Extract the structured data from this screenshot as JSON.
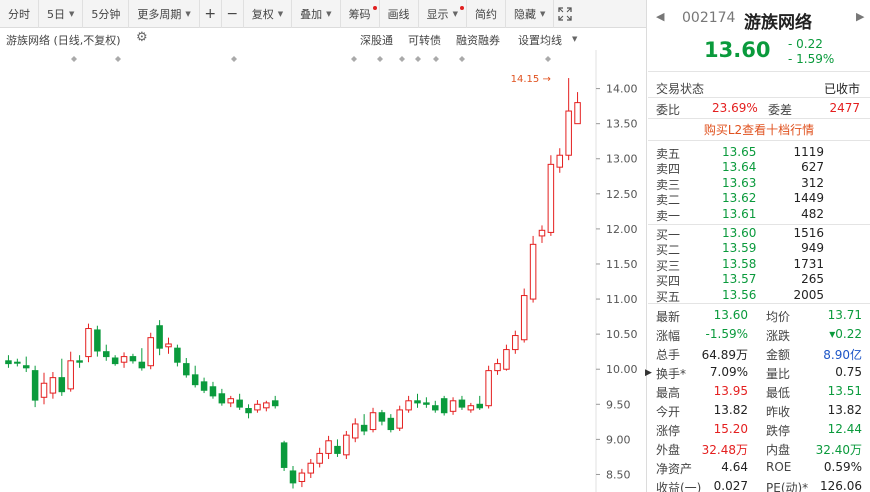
{
  "toolbar": {
    "buttons": [
      {
        "label": "分时",
        "dropdown": false,
        "dot": false
      },
      {
        "label": "5日",
        "dropdown": true,
        "dot": false
      },
      {
        "label": "5分钟",
        "dropdown": false,
        "dot": false
      },
      {
        "label": "更多周期",
        "dropdown": true,
        "dot": false
      }
    ],
    "zoom_in": "+",
    "zoom_out": "−",
    "buttons2": [
      {
        "label": "复权",
        "dropdown": true,
        "dot": false
      },
      {
        "label": "叠加",
        "dropdown": true,
        "dot": false
      },
      {
        "label": "筹码",
        "dropdown": false,
        "dot": true
      },
      {
        "label": "画线",
        "dropdown": false,
        "dot": false
      },
      {
        "label": "显示",
        "dropdown": true,
        "dot": true
      },
      {
        "label": "简约",
        "dropdown": false,
        "dot": false
      },
      {
        "label": "隐藏",
        "dropdown": true,
        "dot": false
      }
    ],
    "fullscreen_icon": "expand-icon"
  },
  "subheader": {
    "stock_label": "游族网络 (日线,不复权)",
    "links": [
      "深股通",
      "可转债",
      "融资融券",
      "设置均线"
    ]
  },
  "chart_data": {
    "type": "candlestick",
    "ylim": [
      8.25,
      14.55
    ],
    "yticks": [
      8.5,
      9.0,
      9.5,
      10.0,
      10.5,
      11.0,
      11.5,
      12.0,
      12.5,
      13.0,
      13.5,
      14.0
    ],
    "ytick_labels": [
      "8.50",
      "9.00",
      "9.50",
      "10.00",
      "10.50",
      "11.00",
      "11.50",
      "12.00",
      "12.50",
      "13.00",
      "13.50",
      "14.00"
    ],
    "max_label": "14.15",
    "max_value": 14.15,
    "up_color": "#e41f1f",
    "down_color": "#0a9a3c",
    "candles": [
      {
        "o": 10.12,
        "h": 10.2,
        "l": 10.02,
        "c": 10.08
      },
      {
        "o": 10.1,
        "h": 10.15,
        "l": 10.04,
        "c": 10.09
      },
      {
        "o": 10.05,
        "h": 10.18,
        "l": 9.96,
        "c": 10.02
      },
      {
        "o": 9.98,
        "h": 10.05,
        "l": 9.46,
        "c": 9.56
      },
      {
        "o": 9.6,
        "h": 9.95,
        "l": 9.5,
        "c": 9.8
      },
      {
        "o": 9.66,
        "h": 9.96,
        "l": 9.58,
        "c": 9.88
      },
      {
        "o": 9.88,
        "h": 10.15,
        "l": 9.62,
        "c": 9.68
      },
      {
        "o": 9.72,
        "h": 10.25,
        "l": 9.68,
        "c": 10.12
      },
      {
        "o": 10.12,
        "h": 10.2,
        "l": 10.02,
        "c": 10.1
      },
      {
        "o": 10.18,
        "h": 10.65,
        "l": 10.1,
        "c": 10.58
      },
      {
        "o": 10.56,
        "h": 10.62,
        "l": 10.18,
        "c": 10.26
      },
      {
        "o": 10.25,
        "h": 10.35,
        "l": 10.12,
        "c": 10.18
      },
      {
        "o": 10.16,
        "h": 10.2,
        "l": 10.05,
        "c": 10.08
      },
      {
        "o": 10.1,
        "h": 10.24,
        "l": 10.02,
        "c": 10.18
      },
      {
        "o": 10.18,
        "h": 10.22,
        "l": 10.08,
        "c": 10.12
      },
      {
        "o": 10.1,
        "h": 10.3,
        "l": 9.98,
        "c": 10.02
      },
      {
        "o": 10.05,
        "h": 10.52,
        "l": 10.0,
        "c": 10.45
      },
      {
        "o": 10.62,
        "h": 10.7,
        "l": 10.2,
        "c": 10.3
      },
      {
        "o": 10.32,
        "h": 10.45,
        "l": 10.22,
        "c": 10.36
      },
      {
        "o": 10.3,
        "h": 10.35,
        "l": 10.04,
        "c": 10.1
      },
      {
        "o": 10.08,
        "h": 10.16,
        "l": 9.88,
        "c": 9.92
      },
      {
        "o": 9.92,
        "h": 10.05,
        "l": 9.74,
        "c": 9.78
      },
      {
        "o": 9.82,
        "h": 9.88,
        "l": 9.66,
        "c": 9.7
      },
      {
        "o": 9.75,
        "h": 9.82,
        "l": 9.58,
        "c": 9.62
      },
      {
        "o": 9.65,
        "h": 9.72,
        "l": 9.48,
        "c": 9.52
      },
      {
        "o": 9.52,
        "h": 9.62,
        "l": 9.46,
        "c": 9.58
      },
      {
        "o": 9.56,
        "h": 9.65,
        "l": 9.42,
        "c": 9.46
      },
      {
        "o": 9.44,
        "h": 9.5,
        "l": 9.3,
        "c": 9.38
      },
      {
        "o": 9.42,
        "h": 9.56,
        "l": 9.38,
        "c": 9.5
      },
      {
        "o": 9.45,
        "h": 9.55,
        "l": 9.4,
        "c": 9.52
      },
      {
        "o": 9.55,
        "h": 9.62,
        "l": 9.44,
        "c": 9.48
      },
      {
        "o": 8.95,
        "h": 8.98,
        "l": 8.55,
        "c": 8.6
      },
      {
        "o": 8.55,
        "h": 8.62,
        "l": 8.3,
        "c": 8.38
      },
      {
        "o": 8.4,
        "h": 8.58,
        "l": 8.32,
        "c": 8.52
      },
      {
        "o": 8.52,
        "h": 8.72,
        "l": 8.45,
        "c": 8.66
      },
      {
        "o": 8.66,
        "h": 8.88,
        "l": 8.6,
        "c": 8.8
      },
      {
        "o": 8.8,
        "h": 9.05,
        "l": 8.72,
        "c": 8.98
      },
      {
        "o": 8.9,
        "h": 9.0,
        "l": 8.75,
        "c": 8.8
      },
      {
        "o": 8.78,
        "h": 9.12,
        "l": 8.72,
        "c": 9.06
      },
      {
        "o": 9.02,
        "h": 9.3,
        "l": 8.96,
        "c": 9.22
      },
      {
        "o": 9.2,
        "h": 9.36,
        "l": 9.06,
        "c": 9.12
      },
      {
        "o": 9.14,
        "h": 9.45,
        "l": 9.1,
        "c": 9.38
      },
      {
        "o": 9.38,
        "h": 9.42,
        "l": 9.2,
        "c": 9.26
      },
      {
        "o": 9.3,
        "h": 9.36,
        "l": 9.1,
        "c": 9.14
      },
      {
        "o": 9.16,
        "h": 9.48,
        "l": 9.12,
        "c": 9.42
      },
      {
        "o": 9.42,
        "h": 9.62,
        "l": 9.38,
        "c": 9.55
      },
      {
        "o": 9.55,
        "h": 9.65,
        "l": 9.45,
        "c": 9.52
      },
      {
        "o": 9.52,
        "h": 9.6,
        "l": 9.45,
        "c": 9.5
      },
      {
        "o": 9.48,
        "h": 9.55,
        "l": 9.38,
        "c": 9.42
      },
      {
        "o": 9.58,
        "h": 9.62,
        "l": 9.34,
        "c": 9.38
      },
      {
        "o": 9.4,
        "h": 9.6,
        "l": 9.35,
        "c": 9.55
      },
      {
        "o": 9.56,
        "h": 9.62,
        "l": 9.42,
        "c": 9.46
      },
      {
        "o": 9.42,
        "h": 9.52,
        "l": 9.38,
        "c": 9.48
      },
      {
        "o": 9.5,
        "h": 9.62,
        "l": 9.42,
        "c": 9.45
      },
      {
        "o": 9.48,
        "h": 10.05,
        "l": 9.44,
        "c": 9.98
      },
      {
        "o": 9.98,
        "h": 10.15,
        "l": 9.92,
        "c": 10.08
      },
      {
        "o": 10.0,
        "h": 10.35,
        "l": 9.98,
        "c": 10.28
      },
      {
        "o": 10.28,
        "h": 10.55,
        "l": 10.22,
        "c": 10.48
      },
      {
        "o": 10.42,
        "h": 11.15,
        "l": 10.38,
        "c": 11.05
      },
      {
        "o": 11.0,
        "h": 11.9,
        "l": 10.95,
        "c": 11.78
      },
      {
        "o": 11.9,
        "h": 12.05,
        "l": 11.8,
        "c": 11.98
      },
      {
        "o": 11.95,
        "h": 13.05,
        "l": 11.9,
        "c": 12.92
      },
      {
        "o": 12.88,
        "h": 13.15,
        "l": 12.8,
        "c": 13.05
      },
      {
        "o": 13.05,
        "h": 14.15,
        "l": 12.98,
        "c": 13.68
      },
      {
        "o": 13.5,
        "h": 13.95,
        "l": 13.51,
        "c": 13.8
      }
    ],
    "markers": [
      "diamond",
      "diamond",
      "diamond",
      "diamond",
      "diamond",
      "diamond",
      "diamond",
      "diamond",
      "diamond",
      "diamond"
    ]
  },
  "quote": {
    "code": "002174",
    "name": "游族网络",
    "price": "13.60",
    "change": "- 0.22",
    "change_pct": "- 1.59%",
    "status_label": "交易状态",
    "status_value": "已收市",
    "weibi_label": "委比",
    "weibi_value": "23.69%",
    "weicha_label": "委差",
    "weicha_value": "2477",
    "l2_link": "购买L2查看十档行情",
    "sell": [
      {
        "label": "卖五",
        "price": "13.65",
        "vol": "1119"
      },
      {
        "label": "卖四",
        "price": "13.64",
        "vol": "627"
      },
      {
        "label": "卖三",
        "price": "13.63",
        "vol": "312"
      },
      {
        "label": "卖二",
        "price": "13.62",
        "vol": "1449"
      },
      {
        "label": "卖一",
        "price": "13.61",
        "vol": "482"
      }
    ],
    "buy": [
      {
        "label": "买一",
        "price": "13.60",
        "vol": "1516"
      },
      {
        "label": "买二",
        "price": "13.59",
        "vol": "949"
      },
      {
        "label": "买三",
        "price": "13.58",
        "vol": "1731"
      },
      {
        "label": "买四",
        "price": "13.57",
        "vol": "265"
      },
      {
        "label": "买五",
        "price": "13.56",
        "vol": "2005"
      }
    ],
    "stats": [
      {
        "l1": "最新",
        "v1": "13.60",
        "c1": "green",
        "l2": "均价",
        "v2": "13.71",
        "c2": "green"
      },
      {
        "l1": "涨幅",
        "v1": "-1.59%",
        "c1": "green",
        "l2": "涨跌",
        "v2": "▾0.22",
        "c2": "green"
      },
      {
        "l1": "总手",
        "v1": "64.89万",
        "c1": "dark",
        "l2": "金额",
        "v2": "8.90亿",
        "c2": "blue"
      },
      {
        "l1": "换手*",
        "v1": "7.09%",
        "c1": "dark",
        "l2": "量比",
        "v2": "0.75",
        "c2": "dark"
      },
      {
        "l1": "最高",
        "v1": "13.95",
        "c1": "red",
        "l2": "最低",
        "v2": "13.51",
        "c2": "green"
      },
      {
        "l1": "今开",
        "v1": "13.82",
        "c1": "dark",
        "l2": "昨收",
        "v2": "13.82",
        "c2": "dark"
      },
      {
        "l1": "涨停",
        "v1": "15.20",
        "c1": "red",
        "l2": "跌停",
        "v2": "12.44",
        "c2": "green"
      },
      {
        "l1": "外盘",
        "v1": "32.48万",
        "c1": "red",
        "l2": "内盘",
        "v2": "32.40万",
        "c2": "green"
      },
      {
        "l1": "净资产",
        "v1": "4.64",
        "c1": "dark",
        "l2": "ROE",
        "v2": "0.59%",
        "c2": "dark"
      },
      {
        "l1": "收益(一)",
        "v1": "0.027",
        "c1": "dark",
        "l2": "PE(动)*",
        "v2": "126.06",
        "c2": "dark"
      }
    ]
  }
}
